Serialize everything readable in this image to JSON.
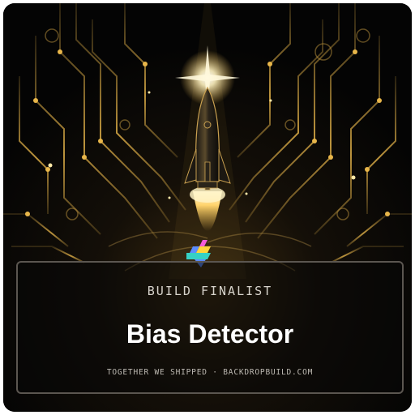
{
  "badge": {
    "label": "BUILD FINALIST",
    "project_title": "Bias Detector",
    "footer": "TOGETHER WE SHIPPED · BACKDROPBUILD.COM"
  },
  "art": {
    "subject": "rocket-launch",
    "accent_color": "#e8b64a",
    "glow_color": "#fff2c0",
    "background_color": "#050505"
  },
  "logo": {
    "icon": "backdrop-build-logo",
    "colors": [
      "#f55bd9",
      "#5b8cff",
      "#ffd43b",
      "#36d1c4"
    ]
  }
}
